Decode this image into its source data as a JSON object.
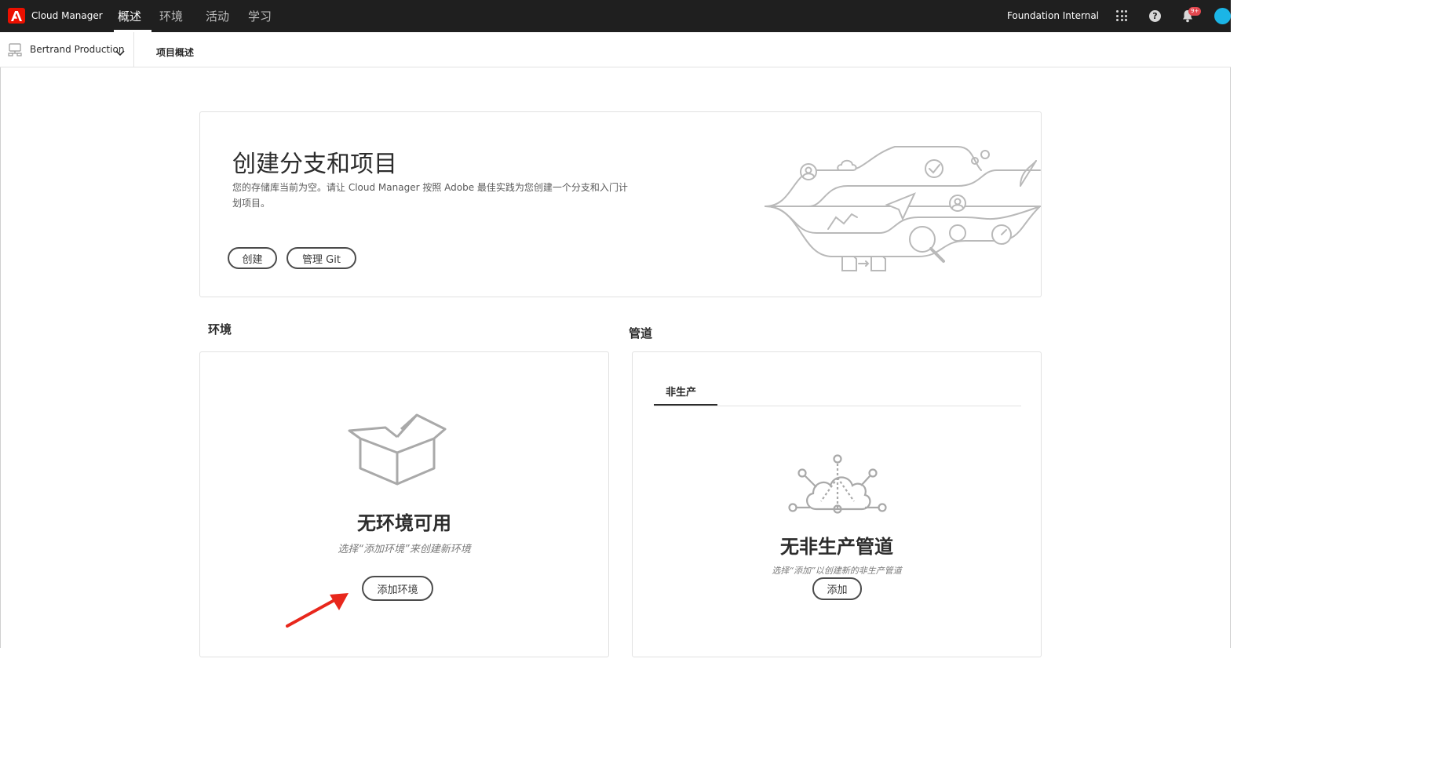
{
  "topnav": {
    "app_title": "Cloud Manager",
    "tabs": [
      {
        "label": "概述",
        "active": true
      },
      {
        "label": "环境",
        "active": false
      },
      {
        "label": "活动",
        "active": false
      },
      {
        "label": "学习",
        "active": false
      }
    ],
    "org_name": "Foundation Internal",
    "notification_badge": "9+",
    "icons": [
      "adobe-logo-icon",
      "apps-grid-icon",
      "help-icon",
      "bell-icon",
      "avatar"
    ]
  },
  "subheader": {
    "program_name": "Bertrand Production",
    "page_title": "项目概述"
  },
  "hero": {
    "title": "创建分支和项目",
    "description": "您的存储库当前为空。请让 Cloud Manager 按照 Adobe 最佳实践为您创建一个分支和入门计划项目。",
    "create_label": "创建",
    "manage_git_label": "管理 Git"
  },
  "environments": {
    "section_label": "环境",
    "empty_title": "无环境可用",
    "empty_subtitle": "选择“添加环境”来创建新环境",
    "add_label": "添加环境"
  },
  "pipelines": {
    "section_label": "管道",
    "tab_label": "非生产",
    "empty_title": "无非生产管道",
    "empty_subtitle": "选择“添加”以创建新的非生产管道",
    "add_label": "添加"
  },
  "colors": {
    "topnav_bg": "#1f1f1f",
    "adobe_red": "#eb1000",
    "annotation_arrow": "#e8271c",
    "avatar": "#1bb5e6"
  }
}
